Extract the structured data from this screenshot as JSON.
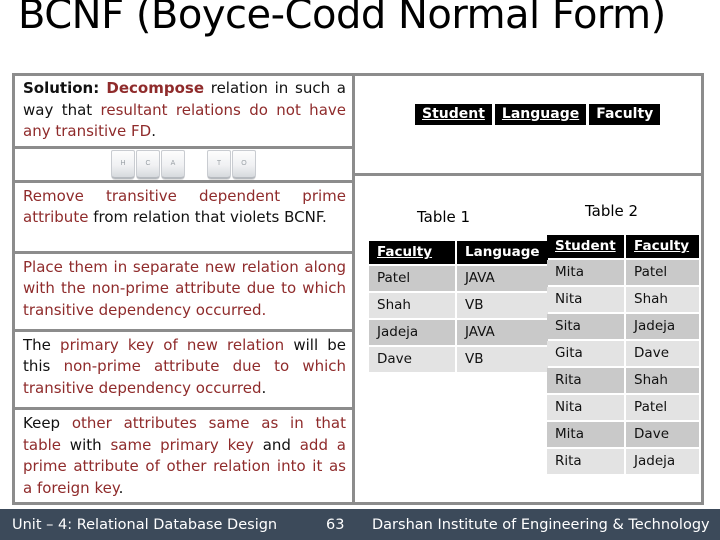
{
  "slide": {
    "title": "BCNF (Boyce-Codd Normal Form)"
  },
  "left_panel": {
    "solution": {
      "label": "Solution:",
      "part1": " Decompose",
      "part2": " relation in such a way that ",
      "part3": "resultant relations do not have any transitive FD",
      "part4": "."
    },
    "keys": {
      "group1": [
        "H",
        "C",
        "A"
      ],
      "group2": [
        "T",
        "O"
      ]
    },
    "rules": [
      {
        "id": "rule-1",
        "segments": [
          {
            "text": "Remove transitive dependent prime attribute",
            "color": "red"
          },
          {
            "text": " from relation that violets BCNF.",
            "color": "black"
          }
        ]
      },
      {
        "id": "rule-2",
        "segments": [
          {
            "text": "Place them in separate new relation along with the non-prime attribute due to which transitive dependency occurred.",
            "color": "red"
          }
        ]
      },
      {
        "id": "rule-3",
        "segments": [
          {
            "text": "The ",
            "color": "black"
          },
          {
            "text": "primary key of new relation",
            "color": "red"
          },
          {
            "text": " will be this ",
            "color": "black"
          },
          {
            "text": "non-prime attribute due to which transitive dependency occurred",
            "color": "red"
          },
          {
            "text": ".",
            "color": "black"
          }
        ]
      },
      {
        "id": "rule-4",
        "segments": [
          {
            "text": "Keep ",
            "color": "black"
          },
          {
            "text": "other attributes same as in that table",
            "color": "red"
          },
          {
            "text": " with ",
            "color": "black"
          },
          {
            "text": "same primary key",
            "color": "red"
          },
          {
            "text": " and ",
            "color": "black"
          },
          {
            "text": "add a prime attribute of other relation into it as a foreign key",
            "color": "red"
          },
          {
            "text": ".",
            "color": "black"
          }
        ]
      }
    ]
  },
  "right_panel": {
    "original_relation": {
      "columns": [
        {
          "label": "Student",
          "primary_key": true
        },
        {
          "label": "Language",
          "primary_key": true
        },
        {
          "label": "Faculty",
          "primary_key": false
        }
      ]
    },
    "tables": [
      {
        "caption": "Table 1",
        "columns": [
          {
            "label": "Faculty",
            "primary_key": true
          },
          {
            "label": "Language",
            "primary_key": false
          }
        ],
        "rows": [
          [
            "Patel",
            "JAVA"
          ],
          [
            "Shah",
            "VB"
          ],
          [
            "Jadeja",
            "JAVA"
          ],
          [
            "Dave",
            "VB"
          ]
        ]
      },
      {
        "caption": "Table 2",
        "columns": [
          {
            "label": "Student",
            "primary_key": true
          },
          {
            "label": "Faculty",
            "primary_key": true
          }
        ],
        "rows": [
          [
            "Mita",
            "Patel"
          ],
          [
            "Nita",
            "Shah"
          ],
          [
            "Sita",
            "Jadeja"
          ],
          [
            "Gita",
            "Dave"
          ],
          [
            "Rita",
            "Shah"
          ],
          [
            "Nita",
            "Patel"
          ],
          [
            "Mita",
            "Dave"
          ],
          [
            "Rita",
            "Jadeja"
          ]
        ]
      }
    ]
  },
  "footer": {
    "unit": "Unit – 4: Relational Database Design",
    "page": "63",
    "institute": "Darshan Institute of Engineering & Technology",
    "background_color": "#3c4a5a",
    "text_color": "#ffffff"
  },
  "colors": {
    "highlight_text": "#8f2b2b",
    "body_text": "#111111",
    "frame_border": "#8c8c8c",
    "header_chip_bg": "#000000",
    "row_even_bg": "#c9c9c9",
    "row_odd_bg": "#e3e3e3"
  }
}
